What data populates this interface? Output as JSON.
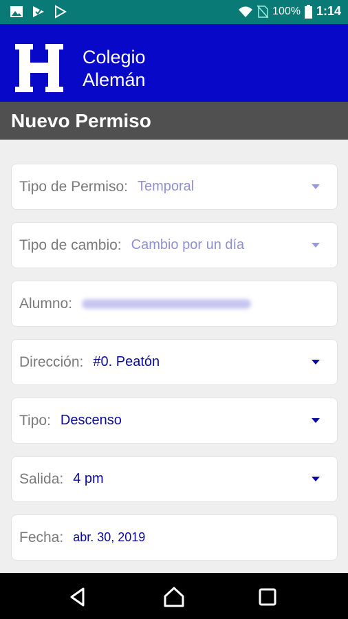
{
  "status_bar": {
    "battery_pct": "100%",
    "time": "1:14",
    "icons": [
      "image-icon",
      "check-icon",
      "play-store-icon",
      "wifi-icon",
      "no-sim-icon",
      "battery-icon"
    ]
  },
  "header": {
    "logo_letter": "H",
    "school_line1": "Colegio",
    "school_line2": "Alemán"
  },
  "page_title": "Nuevo Permiso",
  "form": {
    "tipo_permiso": {
      "label": "Tipo de Permiso:",
      "value": "Temporal"
    },
    "tipo_cambio": {
      "label": "Tipo de cambio:",
      "value": "Cambio por un día"
    },
    "alumno": {
      "label": "Alumno:"
    },
    "direccion": {
      "label": "Dirección:",
      "value": "#0. Peatón"
    },
    "tipo": {
      "label": "Tipo:",
      "value": "Descenso"
    },
    "salida": {
      "label": "Salida:",
      "value": "4 pm"
    },
    "fecha": {
      "label": "Fecha:",
      "value": "abr. 30, 2019"
    }
  },
  "colors": {
    "status_bar": "#0a7a76",
    "header": "#0808c8",
    "title_bar": "#505050",
    "value_text": "#0a0aa0"
  }
}
